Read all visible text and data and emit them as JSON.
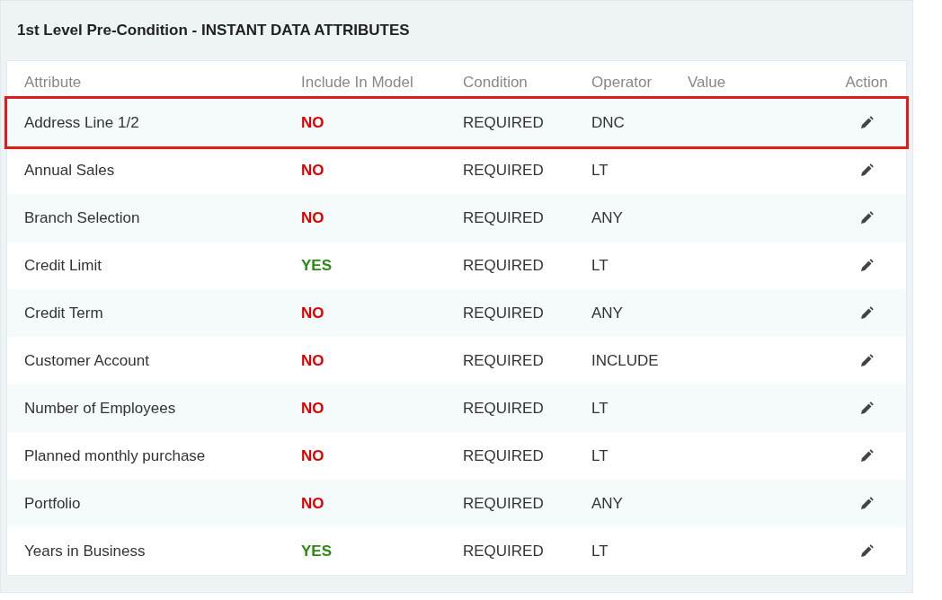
{
  "panel": {
    "title": "1st Level Pre-Condition - INSTANT DATA ATTRIBUTES"
  },
  "table": {
    "columns": [
      "Attribute",
      "Include In Model",
      "Condition",
      "Operator",
      "Value",
      "Action"
    ],
    "rows": [
      {
        "attribute": "Address Line 1/2",
        "include": "NO",
        "included": false,
        "condition": "REQUIRED",
        "operator": "DNC",
        "highlighted": true
      },
      {
        "attribute": "Annual Sales",
        "include": "NO",
        "included": false,
        "condition": "REQUIRED",
        "operator": "LT",
        "highlighted": false
      },
      {
        "attribute": "Branch Selection",
        "include": "NO",
        "included": false,
        "condition": "REQUIRED",
        "operator": "ANY",
        "highlighted": false
      },
      {
        "attribute": "Credit Limit",
        "include": "YES",
        "included": true,
        "condition": "REQUIRED",
        "operator": "LT",
        "highlighted": false
      },
      {
        "attribute": "Credit Term",
        "include": "NO",
        "included": false,
        "condition": "REQUIRED",
        "operator": "ANY",
        "highlighted": false
      },
      {
        "attribute": "Customer Account",
        "include": "NO",
        "included": false,
        "condition": "REQUIRED",
        "operator": "INCLUDE",
        "highlighted": false
      },
      {
        "attribute": "Number of Employees",
        "include": "NO",
        "included": false,
        "condition": "REQUIRED",
        "operator": "LT",
        "highlighted": false
      },
      {
        "attribute": "Planned monthly purchase",
        "include": "NO",
        "included": false,
        "condition": "REQUIRED",
        "operator": "LT",
        "highlighted": false
      },
      {
        "attribute": "Portfolio",
        "include": "NO",
        "included": false,
        "condition": "REQUIRED",
        "operator": "ANY",
        "highlighted": false
      },
      {
        "attribute": "Years in Business",
        "include": "YES",
        "included": true,
        "condition": "REQUIRED",
        "operator": "LT",
        "highlighted": false
      }
    ]
  }
}
